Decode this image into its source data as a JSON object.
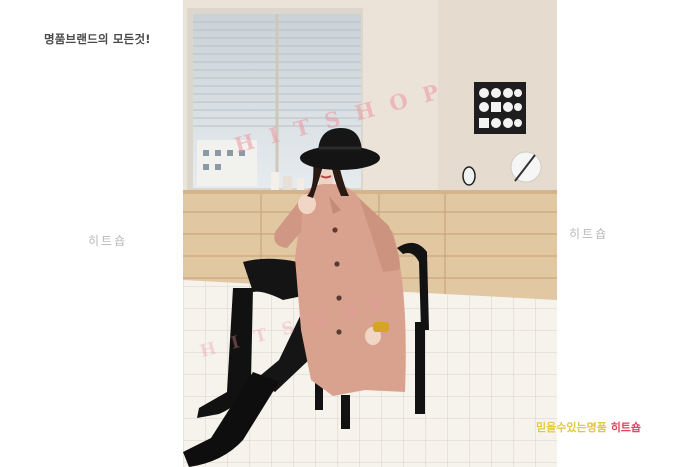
{
  "header": {
    "tagline": "명품브랜드의 모든것!"
  },
  "watermarks": {
    "left": "히트숍",
    "right": "히트숍",
    "photo_top": "HITSHOP",
    "photo_bottom": "HITSHOP"
  },
  "promo": {
    "part1": "믿을수있는명품",
    "part2": "히트숍"
  },
  "colors": {
    "coat": "#d9a28f",
    "wall": "#ece3d8",
    "cabinet": "#e2c7a3",
    "floor": "#f4f0ea",
    "hat": "#1a1a1a",
    "promo_yellow": "#e4c640",
    "promo_red": "#e2445c"
  }
}
